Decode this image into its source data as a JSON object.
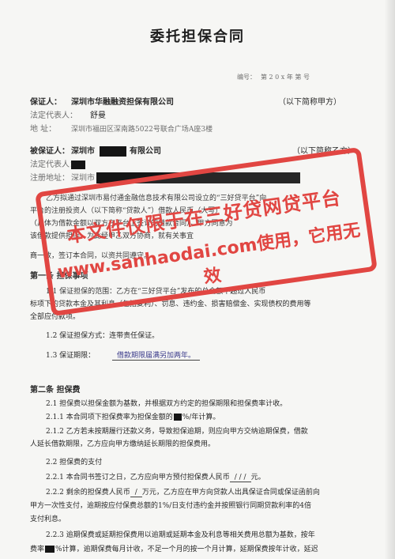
{
  "doc": {
    "title": "委托担保合同",
    "number_label": "编号：",
    "number_value": "第 2 0 x 年 第 号",
    "guarantor": {
      "label": "保证人：",
      "name": "深圳市华融融资担保有限公司",
      "note": "（以下简称甲方）",
      "legal_rep_label": "法定代表人：",
      "legal_rep_value": "舒曼",
      "address_label": "地    址：",
      "address_value": "深圳市福田区深南路5022号联合广场A座3楼"
    },
    "guaranteed": {
      "label": "被保证人：",
      "name_prefix": "深圳市",
      "name_suffix": "有限公司",
      "note": "（以下简称乙方）",
      "legal_rep_label": "法定代表人：",
      "address_label": "注册地址：",
      "address_prefix": "深圳市"
    },
    "intro": [
      "乙方拟通过深圳市易付通金融信息技术有限公司设立的“三好贷平台”向",
      "平台的注册投资人（以下简称“贷款人”）借款人民币（大写）",
      "（具体为借款金额以双方在平台上签订的借款合同），甲方同意为",
      "该借款提供担保，为此经甲乙双方协商，就有关事宜",
      "商一致，签订本合同，以资共同遵守。"
    ],
    "section1": {
      "heading": "第一条  担保事项",
      "items": [
        "1.1  保证担保的范围：乙方在“三好贷平台”发布的总金额不超过人民币",
        "标项下的贷款本金及其利息（包括复利）、罚息、违约金、损害赔偿金、实现债权的费用等",
        "全部应付款项。",
        "1.2  保证担保方式：连带责任保证。"
      ],
      "period_label": "1.3  保证期限：",
      "period_value": "借款期限届满另加两年。"
    },
    "section2": {
      "heading": "第二条  担保费",
      "p21": "2.1  担保费以担保金额为基数，并根据双方约定的担保期限和担保费率计收。",
      "p211": "2.1.1  本合同项下担保费率为担保金额的",
      "p211_tail": "%/年计算。",
      "p212": "2.1.2  乙方若未按期履行还款义务，导致担保逾期，则应向甲方交纳逾期保费，借款",
      "p212b": "人延长借款期限，乙方应向甲方缴纳延长期限的担保费用。",
      "p22": "2.2  担保费的支付",
      "p221": "2.2.1  本合同书签订之日，乙方应向甲方预付担保费人民币",
      "p221_value": "/ / /",
      "p221_tail": "元。",
      "p222": "2.2.2  剩余的担保费人民币",
      "p222_value": "/",
      "p222_tail": "万元，乙方应在甲方向贷款人出具保证合同或保证函前向",
      "p222b": "甲方一次性支付，逾期按应付保费总额的1%/日支付违约金并按照银行同期贷款利率的4倍",
      "p222c": "支付利息。",
      "p223": "2.2.3  逾期保费或延期担保费用以逾期或延期本金及利息等相关费用总额为基数，按年",
      "p223b_prefix": "费率",
      "p223b_tail": "%计算，逾期保费每月计收，不足一个月的按一个月计算，延期保费按年计收，延迟"
    },
    "watermark": {
      "line1": "本文件仅限于在三好贷网贷平台",
      "line2": "www.sanhaodai.com使用，它用无效"
    }
  }
}
